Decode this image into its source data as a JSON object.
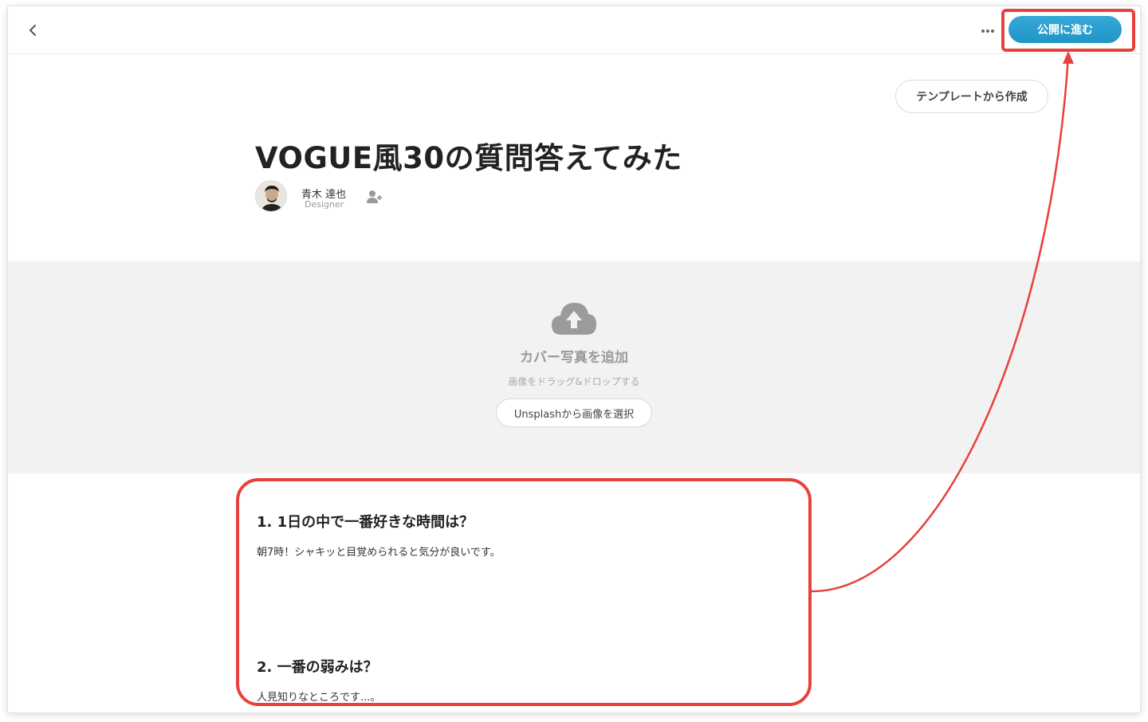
{
  "topbar": {
    "back_icon": "chevron-left-icon",
    "more_icon": "ellipsis-icon",
    "publish_label": "公開に進む"
  },
  "template_button": {
    "label": "テンプレートから作成"
  },
  "article": {
    "title": "VOGUE風30の質問答えてみた",
    "author": {
      "name": "青木 達也",
      "role": "Designer"
    }
  },
  "cover": {
    "icon": "cloud-upload-icon",
    "title": "カバー写真を追加",
    "subtitle": "画像をドラッグ&ドロップする",
    "unsplash_label": "Unsplashから画像を選択"
  },
  "body": {
    "items": [
      {
        "heading": "1. 1日の中で一番好きな時間は？",
        "answer": "朝7時！シャキッと目覚められると気分が良いです。"
      },
      {
        "heading": "2. 一番の弱みは？",
        "answer": "人見知りなところです...。"
      }
    ]
  },
  "colors": {
    "accent": "#2a9fd2",
    "annotation": "#e8403a",
    "cover_bg": "#f2f2f2"
  }
}
